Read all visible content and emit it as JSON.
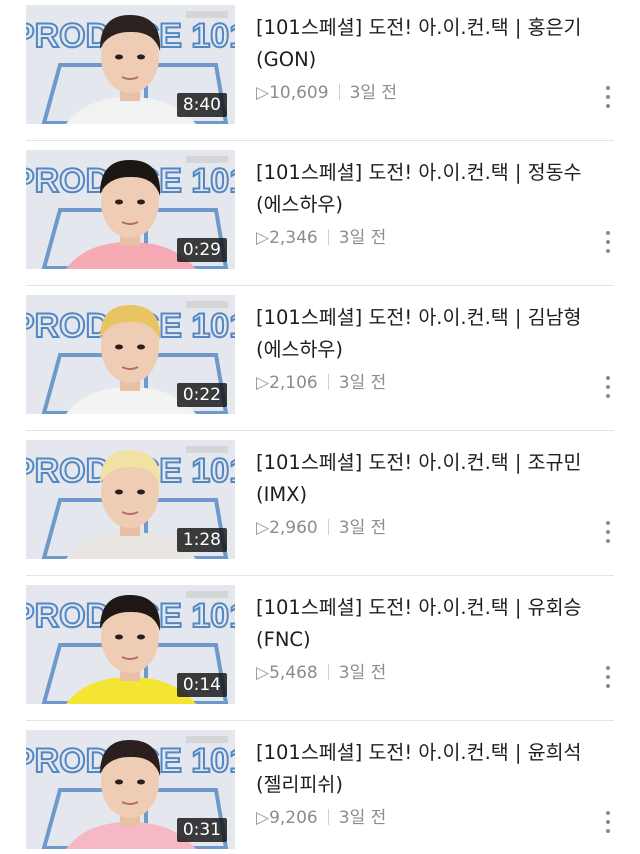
{
  "videos": [
    {
      "title_line1": "[101스페셜] 도전! 아.이.컨.택 | 홍은기",
      "title_line2": "(GON)",
      "views": "10,609",
      "age": "3일 전",
      "duration": "8:40",
      "shirt_color": "#f2f2f2",
      "hair_color": "#2b2220"
    },
    {
      "title_line1": "[101스페셜] 도전! 아.이.컨.택 | 정동수",
      "title_line2": "(에스하우)",
      "views": "2,346",
      "age": "3일 전",
      "duration": "0:29",
      "shirt_color": "#f4a9b5",
      "hair_color": "#1c1614"
    },
    {
      "title_line1": "[101스페셜] 도전! 아.이.컨.택 | 김남형",
      "title_line2": "(에스하우)",
      "views": "2,106",
      "age": "3일 전",
      "duration": "0:22",
      "shirt_color": "#f3f3f3",
      "hair_color": "#e8c463"
    },
    {
      "title_line1": "[101스페셜] 도전! 아.이.컨.택 | 조규민",
      "title_line2": "(IMX)",
      "views": "2,960",
      "age": "3일 전",
      "duration": "1:28",
      "shirt_color": "#e9e6e1",
      "hair_color": "#f1e2a4"
    },
    {
      "title_line1": "[101스페셜] 도전! 아.이.컨.택 | 유회승",
      "title_line2": "(FNC)",
      "views": "5,468",
      "age": "3일 전",
      "duration": "0:14",
      "shirt_color": "#f4e535",
      "hair_color": "#1f1816"
    },
    {
      "title_line1": "[101스페셜] 도전! 아.이.컨.택 | 윤희석",
      "title_line2": "(젤리피쉬)",
      "views": "9,206",
      "age": "3일 전",
      "duration": "0:31",
      "shirt_color": "#f6b8c4",
      "hair_color": "#2a1f1c"
    }
  ],
  "thumbnail_backdrop_text": "PRODUCE 101",
  "icons": {
    "play": "play-outline-icon",
    "more": "more-vertical-icon"
  },
  "colors": {
    "backdrop_blue": "#2f6fb8",
    "backdrop_bg": "#e4e8ee",
    "meta_grey": "#8c8c8c"
  }
}
